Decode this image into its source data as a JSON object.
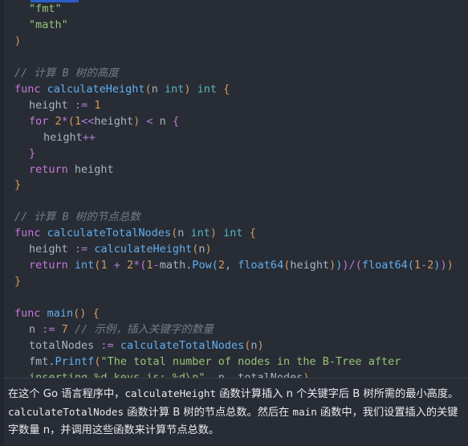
{
  "editor": {
    "theme_background": "#282c34",
    "default_text_color": "#abb2bf",
    "language": "go",
    "selection_bar_color": "#2a5fc9"
  },
  "code": {
    "lines": [
      {
        "id": "line-import-fmt",
        "indent": 1,
        "tokens": [
          {
            "t": "\"fmt\"",
            "c": "str"
          }
        ]
      },
      {
        "id": "line-import-math",
        "indent": 1,
        "tokens": [
          {
            "t": "\"math\"",
            "c": "str"
          }
        ]
      },
      {
        "id": "line-import-close",
        "indent": 0,
        "tokens": [
          {
            "t": ")",
            "c": "par1"
          }
        ]
      },
      {
        "id": "line-blank-1",
        "indent": 0,
        "tokens": []
      },
      {
        "id": "line-comment-height",
        "indent": 0,
        "tokens": [
          {
            "t": "// 计算 B 树的高度",
            "c": "cmt"
          }
        ]
      },
      {
        "id": "line-func-calcheight",
        "indent": 0,
        "tokens": [
          {
            "t": "func ",
            "c": "kw"
          },
          {
            "t": "calculateHeight",
            "c": "fn"
          },
          {
            "t": "(",
            "c": "par1"
          },
          {
            "t": "n ",
            "c": "pn"
          },
          {
            "t": "int",
            "c": "typ"
          },
          {
            "t": ")",
            "c": "par1"
          },
          {
            "t": " ",
            "c": "pn"
          },
          {
            "t": "int",
            "c": "typ"
          },
          {
            "t": " ",
            "c": "pn"
          },
          {
            "t": "{",
            "c": "par1"
          }
        ]
      },
      {
        "id": "line-height-init",
        "indent": 1,
        "tokens": [
          {
            "t": "height ",
            "c": "pn"
          },
          {
            "t": ":=",
            "c": "op"
          },
          {
            "t": " ",
            "c": "pn"
          },
          {
            "t": "1",
            "c": "num"
          }
        ]
      },
      {
        "id": "line-for-loop",
        "indent": 1,
        "tokens": [
          {
            "t": "for ",
            "c": "kw"
          },
          {
            "t": "2",
            "c": "num"
          },
          {
            "t": "*",
            "c": "op"
          },
          {
            "t": "(",
            "c": "par1"
          },
          {
            "t": "1",
            "c": "num"
          },
          {
            "t": "<<",
            "c": "op"
          },
          {
            "t": "height",
            "c": "pn"
          },
          {
            "t": ")",
            "c": "par1"
          },
          {
            "t": " ",
            "c": "pn"
          },
          {
            "t": "<",
            "c": "op"
          },
          {
            "t": " n ",
            "c": "pn"
          },
          {
            "t": "{",
            "c": "par2"
          }
        ]
      },
      {
        "id": "line-height-incr",
        "indent": 2,
        "tokens": [
          {
            "t": "height",
            "c": "pn"
          },
          {
            "t": "++",
            "c": "op"
          }
        ]
      },
      {
        "id": "line-for-close",
        "indent": 1,
        "tokens": [
          {
            "t": "}",
            "c": "par2"
          }
        ]
      },
      {
        "id": "line-return-height",
        "indent": 1,
        "tokens": [
          {
            "t": "return ",
            "c": "kw"
          },
          {
            "t": "height",
            "c": "pn"
          }
        ]
      },
      {
        "id": "line-func-close-1",
        "indent": 0,
        "tokens": [
          {
            "t": "}",
            "c": "par1"
          }
        ]
      },
      {
        "id": "line-blank-2",
        "indent": 0,
        "tokens": []
      },
      {
        "id": "line-comment-total",
        "indent": 0,
        "tokens": [
          {
            "t": "// 计算 B 树的节点总数",
            "c": "cmt"
          }
        ]
      },
      {
        "id": "line-func-calctotal",
        "indent": 0,
        "tokens": [
          {
            "t": "func ",
            "c": "kw"
          },
          {
            "t": "calculateTotalNodes",
            "c": "fn"
          },
          {
            "t": "(",
            "c": "par1"
          },
          {
            "t": "n ",
            "c": "pn"
          },
          {
            "t": "int",
            "c": "typ"
          },
          {
            "t": ")",
            "c": "par1"
          },
          {
            "t": " ",
            "c": "pn"
          },
          {
            "t": "int",
            "c": "typ"
          },
          {
            "t": " ",
            "c": "pn"
          },
          {
            "t": "{",
            "c": "par1"
          }
        ]
      },
      {
        "id": "line-height-assign",
        "indent": 1,
        "tokens": [
          {
            "t": "height ",
            "c": "pn"
          },
          {
            "t": ":=",
            "c": "op"
          },
          {
            "t": " ",
            "c": "pn"
          },
          {
            "t": "calculateHeight",
            "c": "fn"
          },
          {
            "t": "(",
            "c": "par1"
          },
          {
            "t": "n",
            "c": "pn"
          },
          {
            "t": ")",
            "c": "par1"
          }
        ]
      },
      {
        "id": "line-return-total",
        "indent": 1,
        "tokens": [
          {
            "t": "return ",
            "c": "kw"
          },
          {
            "t": "int",
            "c": "fn"
          },
          {
            "t": "(",
            "c": "par1"
          },
          {
            "t": "1",
            "c": "num"
          },
          {
            "t": " ",
            "c": "pn"
          },
          {
            "t": "+",
            "c": "op"
          },
          {
            "t": " ",
            "c": "pn"
          },
          {
            "t": "2",
            "c": "num"
          },
          {
            "t": "*",
            "c": "op"
          },
          {
            "t": "(",
            "c": "par2"
          },
          {
            "t": "1",
            "c": "num"
          },
          {
            "t": "-",
            "c": "op"
          },
          {
            "t": "math",
            "c": "pn"
          },
          {
            "t": ".",
            "c": "pn"
          },
          {
            "t": "Pow",
            "c": "fn"
          },
          {
            "t": "(",
            "c": "par3"
          },
          {
            "t": "2",
            "c": "num"
          },
          {
            "t": ", ",
            "c": "pn"
          },
          {
            "t": "float64",
            "c": "fn"
          },
          {
            "t": "(",
            "c": "par1"
          },
          {
            "t": "height",
            "c": "pn"
          },
          {
            "t": ")",
            "c": "par1"
          },
          {
            "t": ")",
            "c": "par3"
          },
          {
            "t": ")",
            "c": "par2"
          },
          {
            "t": "/",
            "c": "op"
          },
          {
            "t": "(",
            "c": "par2"
          },
          {
            "t": "float64",
            "c": "fn"
          },
          {
            "t": "(",
            "c": "par3"
          },
          {
            "t": "1",
            "c": "num"
          },
          {
            "t": "-",
            "c": "op"
          },
          {
            "t": "2",
            "c": "num"
          },
          {
            "t": ")",
            "c": "par3"
          },
          {
            "t": ")",
            "c": "par2"
          },
          {
            "t": ")",
            "c": "par1"
          }
        ]
      },
      {
        "id": "line-func-close-2",
        "indent": 0,
        "tokens": [
          {
            "t": "}",
            "c": "par1"
          }
        ]
      },
      {
        "id": "line-blank-3",
        "indent": 0,
        "tokens": []
      },
      {
        "id": "line-func-main",
        "indent": 0,
        "tokens": [
          {
            "t": "func ",
            "c": "kw"
          },
          {
            "t": "main",
            "c": "fn"
          },
          {
            "t": "()",
            "c": "par1"
          },
          {
            "t": " ",
            "c": "pn"
          },
          {
            "t": "{",
            "c": "par1"
          }
        ]
      },
      {
        "id": "line-n-assign",
        "indent": 1,
        "tokens": [
          {
            "t": "n ",
            "c": "pn"
          },
          {
            "t": ":=",
            "c": "op"
          },
          {
            "t": " ",
            "c": "pn"
          },
          {
            "t": "7",
            "c": "num"
          },
          {
            "t": " ",
            "c": "pn"
          },
          {
            "t": "// 示例，插入关键字的数量",
            "c": "cmt"
          }
        ]
      },
      {
        "id": "line-totalnodes",
        "indent": 1,
        "tokens": [
          {
            "t": "totalNodes ",
            "c": "pn"
          },
          {
            "t": ":=",
            "c": "op"
          },
          {
            "t": " ",
            "c": "pn"
          },
          {
            "t": "calculateTotalNodes",
            "c": "fn"
          },
          {
            "t": "(",
            "c": "par1"
          },
          {
            "t": "n",
            "c": "pn"
          },
          {
            "t": ")",
            "c": "par1"
          }
        ]
      },
      {
        "id": "line-printf",
        "indent": 1,
        "tokens": [
          {
            "t": "fmt",
            "c": "pn"
          },
          {
            "t": ".",
            "c": "pn"
          },
          {
            "t": "Printf",
            "c": "fn"
          },
          {
            "t": "(",
            "c": "par1"
          },
          {
            "t": "\"The total number of nodes in the B-Tree after inserting %d keys is: %d\\n\"",
            "c": "str"
          },
          {
            "t": ", ",
            "c": "pn"
          },
          {
            "t": "n",
            "c": "pn"
          },
          {
            "t": ", ",
            "c": "pn"
          },
          {
            "t": "totalNodes",
            "c": "pn"
          },
          {
            "t": ")",
            "c": "par1"
          }
        ]
      },
      {
        "id": "line-main-close",
        "indent": 0,
        "tokens": [
          {
            "t": "}",
            "c": "par1"
          }
        ]
      }
    ]
  },
  "explanation": {
    "paragraph": "在这个 Go 语言程序中，calculateHeight 函数计算插入 n 个关键字后 B 树所需的最小高度。calculateTotalNodes 函数计算 B 树的节点总数。然后在 main 函数中，我们设置插入的关键字数量 n，并调用这些函数来计算节点总数。",
    "segments": [
      {
        "text": "在这个 Go 语言程序中，",
        "mono": false
      },
      {
        "text": "calculateHeight",
        "mono": true
      },
      {
        "text": " 函数计算插入 n 个关键字后 B 树所需的最小高度。",
        "mono": false
      },
      {
        "text": "calculateTotalNodes",
        "mono": true
      },
      {
        "text": " 函数计算 B 树的节点总数。然后在 ",
        "mono": false
      },
      {
        "text": "main",
        "mono": true
      },
      {
        "text": " 函数中，我们设置插入的关键字数量 n，并调用这些函数来计算节点总数。",
        "mono": false
      }
    ]
  }
}
